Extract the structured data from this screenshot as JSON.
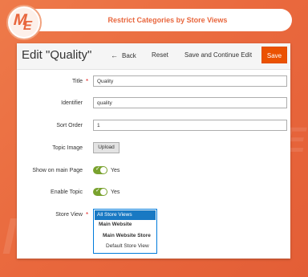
{
  "banner": {
    "title": "Restrict Categories by Store Views"
  },
  "logo": {
    "mark_top": "M",
    "mark_bottom": "E"
  },
  "page": {
    "title": "Edit \"Quality\"",
    "toolbar": {
      "back_label": "Back",
      "reset_label": "Reset",
      "save_continue_label": "Save and Continue Edit",
      "save_label": "Save"
    }
  },
  "form": {
    "title": {
      "label": "Title",
      "value": "Quality",
      "required": "*"
    },
    "identifier": {
      "label": "Identifier",
      "value": "quality"
    },
    "sort_order": {
      "label": "Sort Order",
      "value": "1"
    },
    "topic_image": {
      "label": "Topic Image",
      "button_label": "Upload"
    },
    "show_on_main_page": {
      "label": "Show on main Page",
      "state_label": "Yes",
      "checked": true
    },
    "enable_topic": {
      "label": "Enable Topic",
      "state_label": "Yes",
      "checked": true
    },
    "store_view": {
      "label": "Store View",
      "required": "*",
      "options": [
        "All Store Views",
        "Main Website",
        "Main Website Store",
        "Default Store View"
      ],
      "selected": "All Store Views"
    }
  },
  "colors": {
    "accent": "#e8663d",
    "save_button": "#eb5202",
    "toggle_on": "#79a22e",
    "selected_option": "#1979c3"
  }
}
